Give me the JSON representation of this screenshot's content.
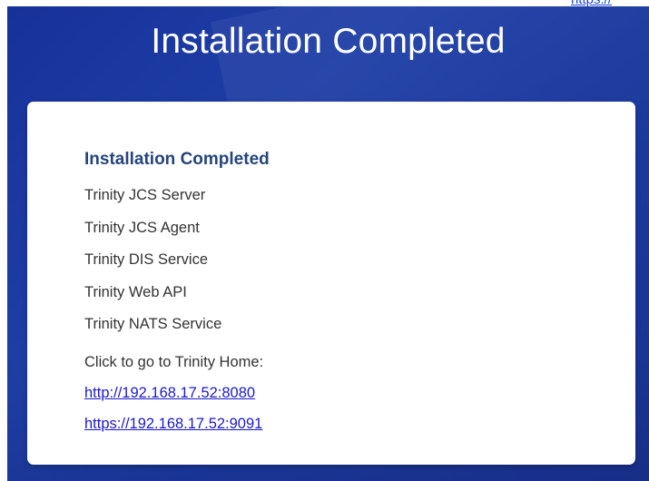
{
  "top_link": "https://",
  "page_title": "Installation Completed",
  "card": {
    "heading": "Installation Completed",
    "services": [
      "Trinity JCS Server",
      "Trinity JCS Agent",
      "Trinity DIS Service",
      "Trinity Web API",
      "Trinity NATS Service"
    ],
    "home_label": "Click to go to Trinity Home:",
    "links": {
      "http": "http://192.168.17.52:8080",
      "https": "https://192.168.17.52:9091"
    }
  },
  "colors": {
    "banner": "#1f3fa6",
    "heading": "#24457d",
    "link": "#1a1acc"
  }
}
